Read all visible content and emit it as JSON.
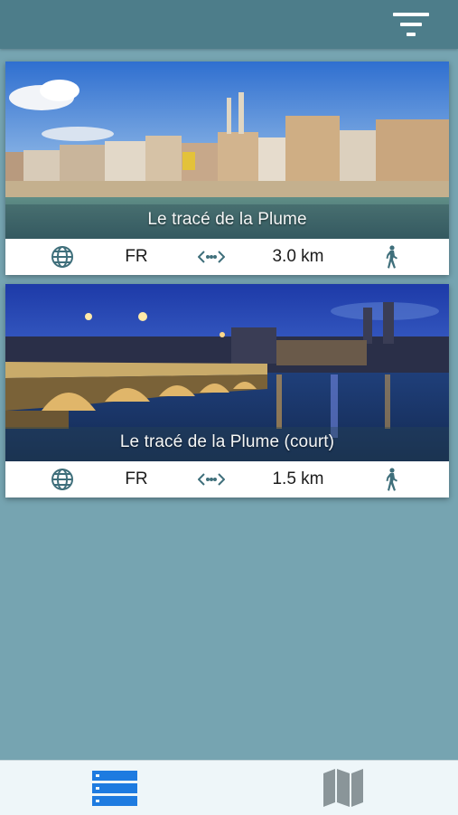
{
  "header": {
    "filter_icon": "filter-icon"
  },
  "routes": [
    {
      "title": "Le tracé de la Plume",
      "language": "FR",
      "distance": "3.0 km",
      "mode_icon": "walking-icon"
    },
    {
      "title": "Le tracé de la Plume (court)",
      "language": "FR",
      "distance": "1.5 km",
      "mode_icon": "walking-icon"
    }
  ],
  "tabbar": {
    "tabs": [
      {
        "name": "list",
        "icon": "list-icon",
        "active": true
      },
      {
        "name": "map",
        "icon": "map-icon",
        "active": false
      }
    ]
  },
  "colors": {
    "background": "#76a4b1",
    "topbar": "#4d7d8a",
    "icon": "#3f6f7b",
    "active_tab": "#1e7be0",
    "inactive_tab": "#8a9599"
  }
}
